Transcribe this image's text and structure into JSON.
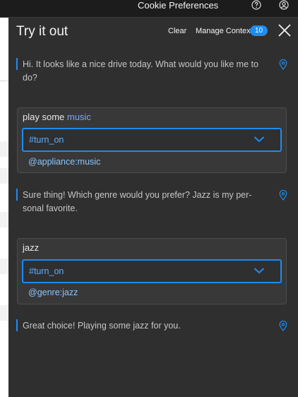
{
  "topbar": {
    "cookie_label": "Cookie Preferences",
    "help_icon": "help-circle-icon",
    "user_icon": "user-avatar-icon"
  },
  "panel": {
    "title": "Try it out",
    "clear_label": "Clear",
    "manage_context_label": "Manage Context",
    "context_count": "10",
    "close_icon": "close-icon"
  },
  "conversation": [
    {
      "type": "bot",
      "text": "Hi. It looks like a nice drive today. What would you like me to do?"
    },
    {
      "type": "user",
      "text_plain": "play some ",
      "text_highlight": "music",
      "intent": "#turn_on",
      "entity": "@appliance:music"
    },
    {
      "type": "bot",
      "text": "Sure thing! Which genre would you prefer? Jazz is my per-sonal favorite."
    },
    {
      "type": "user",
      "text_plain": "jazz",
      "text_highlight": "",
      "intent": "#turn_on",
      "entity": "@genre:jazz"
    },
    {
      "type": "bot",
      "text": "Great choice! Playing some jazz for you."
    }
  ],
  "colors": {
    "accent": "#1e8cf0",
    "panel_bg": "#2f2f2f",
    "card_bg": "#383838",
    "entity": "#8ac6ff"
  }
}
